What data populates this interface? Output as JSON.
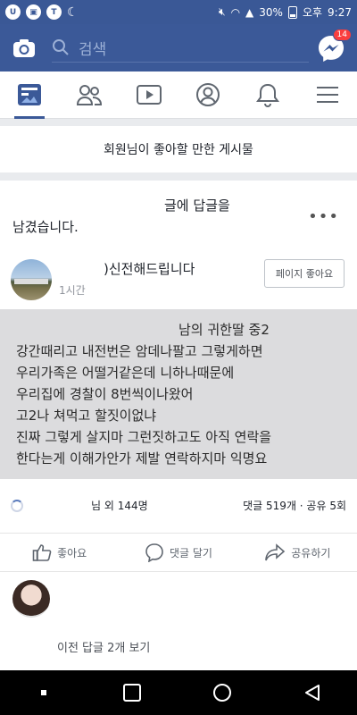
{
  "status_bar": {
    "left_icons": [
      "app-icon",
      "talk-icon",
      "moon-icon"
    ],
    "battery": "30%",
    "ampm": "오후",
    "time": "9:27"
  },
  "top_bar": {
    "search_placeholder": "검색",
    "messenger_badge": "14"
  },
  "nav": {
    "tabs": [
      "news-feed",
      "friends",
      "watch",
      "profile",
      "notifications",
      "menu"
    ]
  },
  "suggested": {
    "header": "회원님이 좋아할 만한 게시물"
  },
  "post": {
    "notice_part1": "글에 답글을",
    "notice_part2": "남겼습니다.",
    "page_name": ")신전해드립니다",
    "time": "1시간",
    "like_page_label": "페이지 좋아요",
    "lines": [
      "남의 귀한딸 중2",
      "강간때리고 내전번은 암데나팔고 그렇게하면",
      "우리가족은 어떨거같은데 니하나때문에",
      "우리집에 경찰이 8번씩이나왔어",
      "고2나 쳐먹고 할짓이없냐",
      "진짜 그렇게 살지마 그런짓하고도 아직 연락을",
      "한다는게 이해가안가 제발 연락하지마 익명요"
    ],
    "reactions_text": "님 외 144명",
    "comments_shares": "댓글 519개 · 공유 5회",
    "actions": {
      "like": "좋아요",
      "comment": "댓글 달기",
      "share": "공유하기"
    },
    "prev_comments": "이전 답글 2개 보기"
  },
  "colors": {
    "brand": "#3b5998",
    "status_bar": "#3a5896",
    "badge": "#fa3e3e"
  }
}
